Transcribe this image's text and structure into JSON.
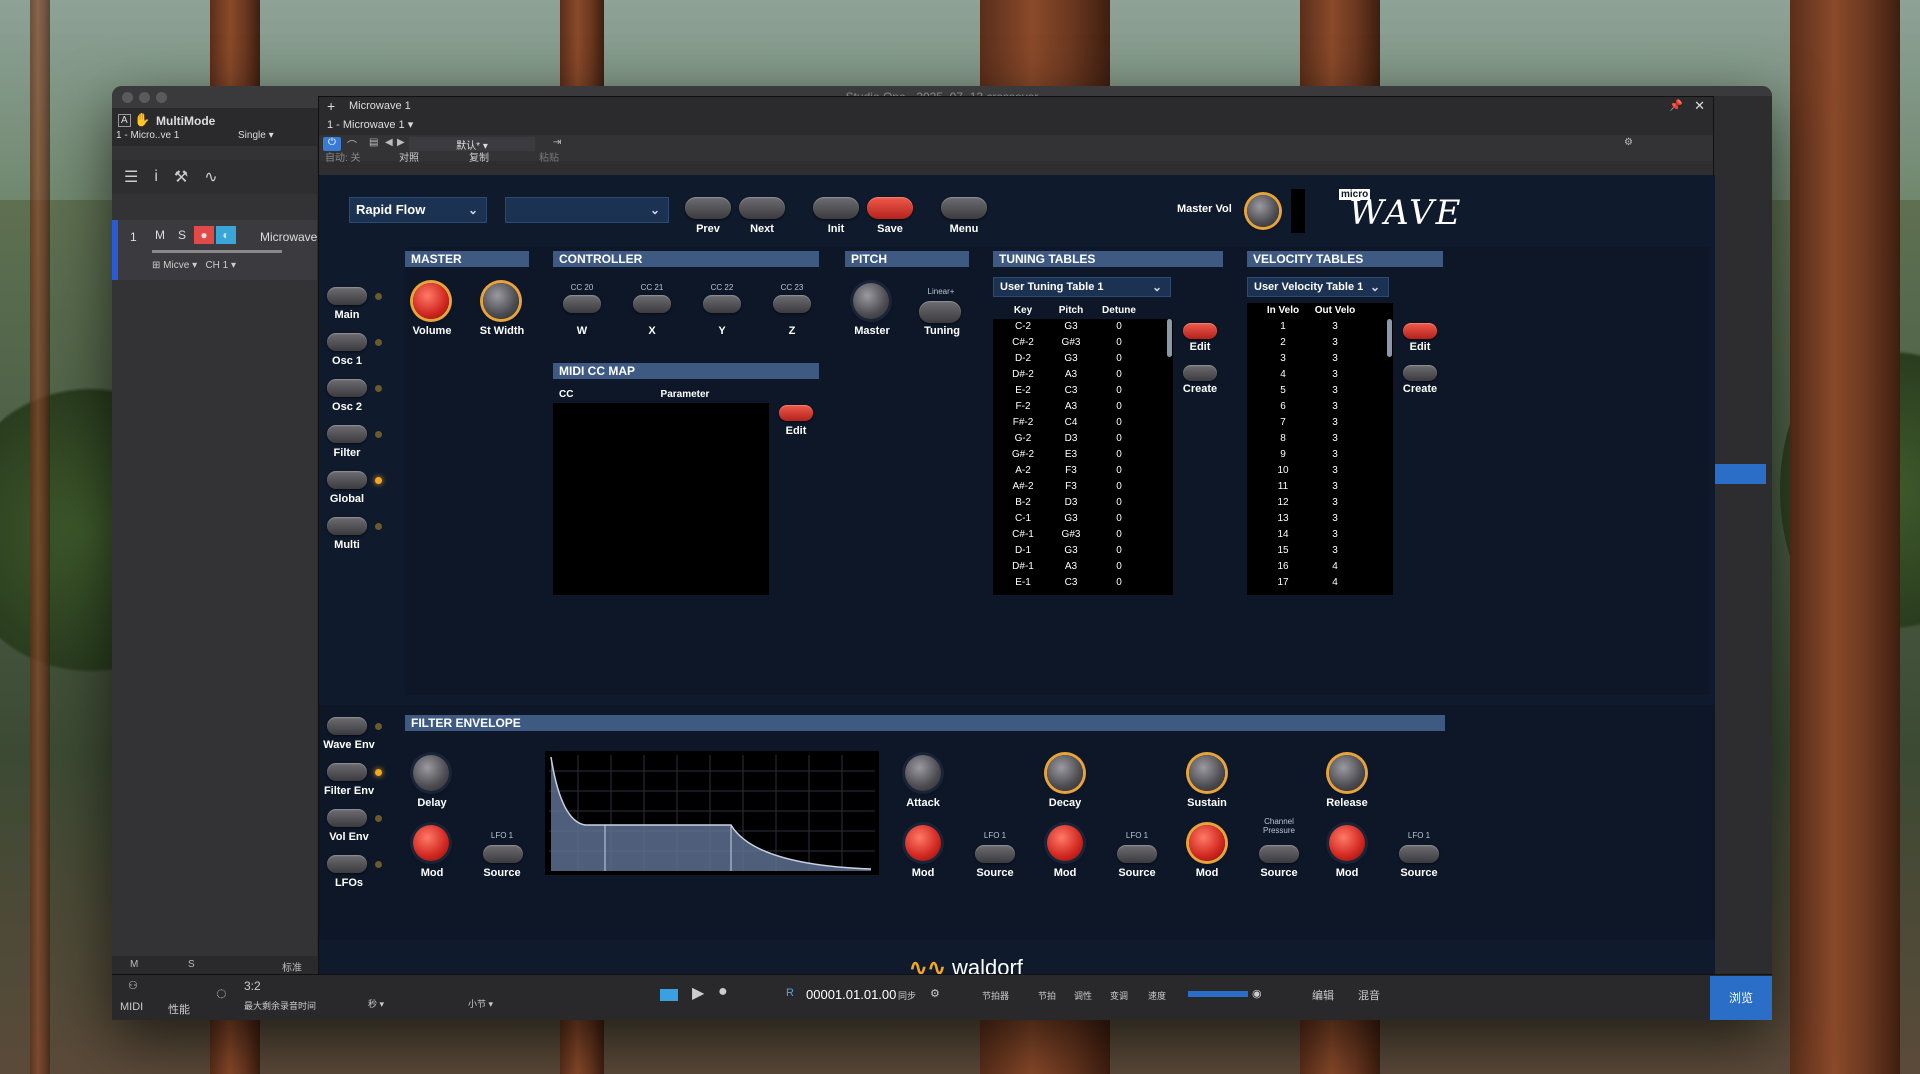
{
  "app": {
    "title": "Studio One - 2025_07_13 crossover",
    "multimode": "MultiMode",
    "instrument_short": "1 - Micro..ve 1",
    "mode": "Single"
  },
  "left_panel": {
    "track_number": "1",
    "mute": "M",
    "solo": "S",
    "track_name": "Microwave",
    "input": "Micve",
    "channel": "CH 1",
    "footer_m": "M",
    "footer_s": "S",
    "footer_std": "标准"
  },
  "plugin_window": {
    "title": "Microwave 1",
    "instance": "1 - Microwave 1",
    "preset_default": "默认*",
    "auto_off": "自动: 关",
    "compare": "对照",
    "copy": "复制",
    "paste": "粘贴"
  },
  "synth": {
    "preset": "Rapid Flow",
    "bank": "",
    "buttons": {
      "prev": "Prev",
      "next": "Next",
      "init": "Init",
      "save": "Save",
      "menu": "Menu"
    },
    "master_vol": "Master Vol",
    "logo_micro": "micro",
    "logo_wave": "WAVE",
    "nav": [
      "Main",
      "Osc 1",
      "Osc 2",
      "Filter",
      "Global",
      "Multi"
    ],
    "nav_bottom": [
      "Wave Env",
      "Filter Env",
      "Vol Env",
      "LFOs"
    ],
    "master": {
      "header": "MASTER",
      "volume": "Volume",
      "st_width": "St Width"
    },
    "controller": {
      "header": "CONTROLLER",
      "cc": [
        "CC 20",
        "CC 21",
        "CC 22",
        "CC 23"
      ],
      "labels": [
        "W",
        "X",
        "Y",
        "Z"
      ]
    },
    "pitch": {
      "header": "PITCH",
      "master": "Master",
      "linear": "Linear+",
      "tuning": "Tuning"
    },
    "midi_cc_map": {
      "header": "MIDI CC MAP",
      "col_cc": "CC",
      "col_param": "Parameter",
      "edit": "Edit"
    },
    "tuning_tables": {
      "header": "TUNING TABLES",
      "selected": "User Tuning Table 1",
      "cols": [
        "Key",
        "Pitch",
        "Detune"
      ],
      "rows": [
        [
          "C-2",
          "G3",
          "0"
        ],
        [
          "C#-2",
          "G#3",
          "0"
        ],
        [
          "D-2",
          "G3",
          "0"
        ],
        [
          "D#-2",
          "A3",
          "0"
        ],
        [
          "E-2",
          "C3",
          "0"
        ],
        [
          "F-2",
          "A3",
          "0"
        ],
        [
          "F#-2",
          "C4",
          "0"
        ],
        [
          "G-2",
          "D3",
          "0"
        ],
        [
          "G#-2",
          "E3",
          "0"
        ],
        [
          "A-2",
          "F3",
          "0"
        ],
        [
          "A#-2",
          "F3",
          "0"
        ],
        [
          "B-2",
          "D3",
          "0"
        ],
        [
          "C-1",
          "G3",
          "0"
        ],
        [
          "C#-1",
          "G#3",
          "0"
        ],
        [
          "D-1",
          "G3",
          "0"
        ],
        [
          "D#-1",
          "A3",
          "0"
        ],
        [
          "E-1",
          "C3",
          "0"
        ]
      ],
      "edit": "Edit",
      "create": "Create"
    },
    "velocity_tables": {
      "header": "VELOCITY TABLES",
      "selected": "User Velocity Table 1",
      "cols": [
        "In Velo",
        "Out Velo"
      ],
      "rows": [
        [
          "1",
          "3"
        ],
        [
          "2",
          "3"
        ],
        [
          "3",
          "3"
        ],
        [
          "4",
          "3"
        ],
        [
          "5",
          "3"
        ],
        [
          "6",
          "3"
        ],
        [
          "7",
          "3"
        ],
        [
          "8",
          "3"
        ],
        [
          "9",
          "3"
        ],
        [
          "10",
          "3"
        ],
        [
          "11",
          "3"
        ],
        [
          "12",
          "3"
        ],
        [
          "13",
          "3"
        ],
        [
          "14",
          "3"
        ],
        [
          "15",
          "3"
        ],
        [
          "16",
          "4"
        ],
        [
          "17",
          "4"
        ]
      ],
      "edit": "Edit",
      "create": "Create"
    },
    "filter_envelope": {
      "header": "FILTER ENVELOPE",
      "delay": "Delay",
      "mod": "Mod",
      "lfo1": "LFO 1",
      "source": "Source",
      "attack": "Attack",
      "decay": "Decay",
      "sustain": "Sustain",
      "release": "Release",
      "channel_pressure": "Channel Pressure"
    },
    "brand": "waldorf"
  },
  "transport": {
    "midi": "MIDI",
    "perf": "性能",
    "time_remaining_label": "最大剩余录音时间",
    "time_partial": "3:2",
    "seconds": "秒",
    "bar": "小节",
    "position": "00001.01.01.00",
    "sync": "同步",
    "metronome": "节拍器",
    "beat": "节拍",
    "tempo_adj": "调性",
    "transpose": "变调",
    "speed": "速度",
    "edit": "编辑",
    "mix": "混音",
    "browse": "浏览",
    "r_label": "R"
  }
}
